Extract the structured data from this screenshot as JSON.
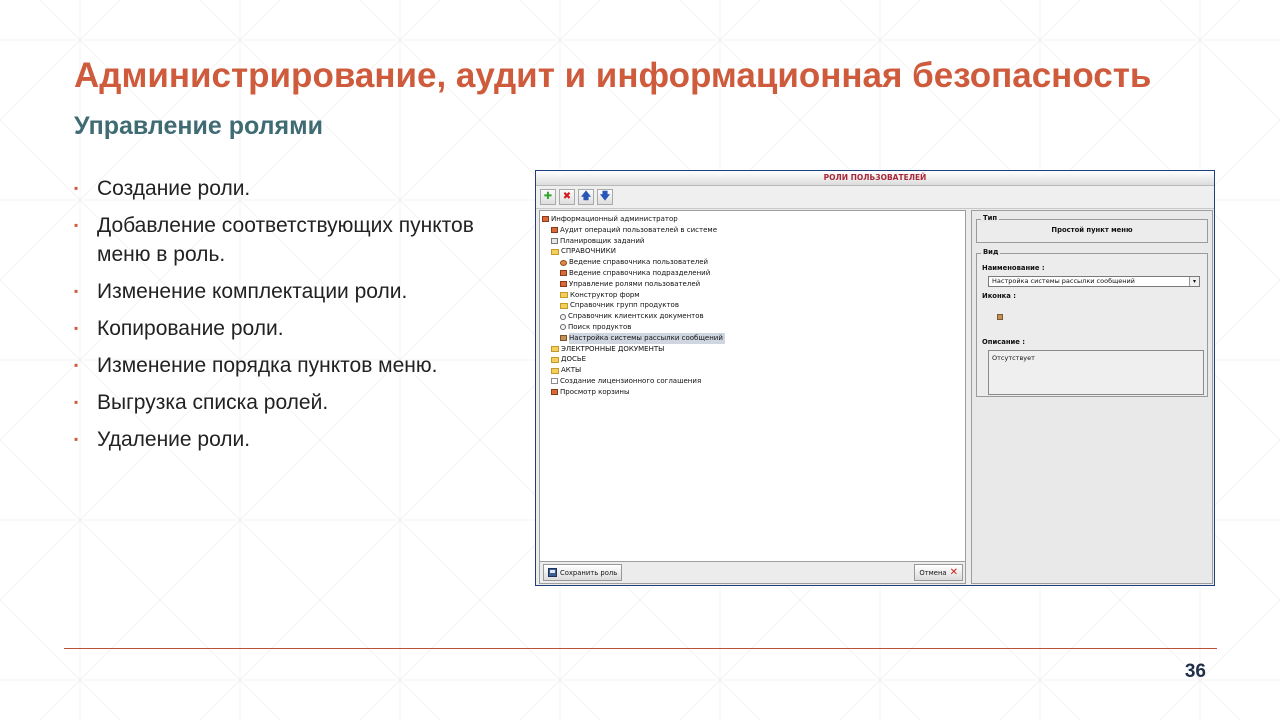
{
  "slide": {
    "title": "Администрирование, аудит и информационная безопасность",
    "subtitle": "Управление ролями",
    "bullets": [
      "Создание роли.",
      "Добавление соответствующих пунктов меню в роль.",
      "Изменение комплектации роли.",
      "Копирование роли.",
      "Изменение порядка пунктов меню.",
      "Выгрузка списка ролей.",
      "Удаление роли."
    ],
    "bullet_marker": "▪",
    "page_number": "36"
  },
  "colors": {
    "title": "#cf5b3d",
    "subtitle": "#3f6b73",
    "window_title": "#a8283a",
    "window_border": "#1d3f7e"
  },
  "app": {
    "window_title": "РОЛИ ПОЛЬЗОВАТЕЛЕЙ",
    "toolbar": [
      {
        "icon": "add-icon",
        "glyph": "✚",
        "color": "#2ea72e"
      },
      {
        "icon": "delete-icon",
        "glyph": "✖",
        "color": "#d21b1b"
      },
      {
        "icon": "move-up-icon",
        "glyph": "🡅",
        "color": "#2a55b8"
      },
      {
        "icon": "move-down-icon",
        "glyph": "🡇",
        "color": "#2a55b8"
      }
    ],
    "tree": [
      {
        "level": 0,
        "icon": "app-icon",
        "label": "Информационный администратор"
      },
      {
        "level": 1,
        "icon": "app-icon",
        "label": "Аудит операций пользователей в системе"
      },
      {
        "level": 1,
        "icon": "calendar-icon",
        "label": "Планировщик заданий"
      },
      {
        "level": 1,
        "icon": "folder-icon",
        "label": "СПРАВОЧНИКИ"
      },
      {
        "level": 2,
        "icon": "user-icon",
        "label": "Ведение справочника пользователей"
      },
      {
        "level": 2,
        "icon": "app-icon",
        "label": "Ведение справочника подразделений"
      },
      {
        "level": 2,
        "icon": "app-icon",
        "label": "Управление ролями пользователей"
      },
      {
        "level": 2,
        "icon": "folder-icon",
        "label": "Конструктор форм"
      },
      {
        "level": 2,
        "icon": "folder-icon",
        "label": "Справочник групп продуктов"
      },
      {
        "level": 2,
        "icon": "search-icon",
        "label": "Справочник клиентских документов"
      },
      {
        "level": 2,
        "icon": "search-icon",
        "label": "Поиск продуктов"
      },
      {
        "level": 2,
        "icon": "mail-icon",
        "label": "Настройка системы рассылки сообщений",
        "selected": true
      },
      {
        "level": 1,
        "icon": "folder-icon",
        "label": "ЭЛЕКТРОННЫЕ ДОКУМЕНТЫ"
      },
      {
        "level": 1,
        "icon": "folder-icon",
        "label": "ДОСЬЕ"
      },
      {
        "level": 1,
        "icon": "folder-icon",
        "label": "АКТЫ"
      },
      {
        "level": 1,
        "icon": "document-icon",
        "label": "Создание лицензионного соглашения"
      },
      {
        "level": 1,
        "icon": "app-icon",
        "label": "Просмотр корзины"
      }
    ],
    "save_button": "Сохранить роль",
    "cancel_button": "Отмена",
    "props": {
      "type_legend": "Тип",
      "type_value": "Простой пункт меню",
      "view_legend": "Вид",
      "name_label": "Наименование :",
      "name_value": "Настройка системы рассылки сообщений",
      "icon_label": "Иконка :",
      "description_label": "Описание :",
      "description_value": "Отсутствует"
    }
  }
}
